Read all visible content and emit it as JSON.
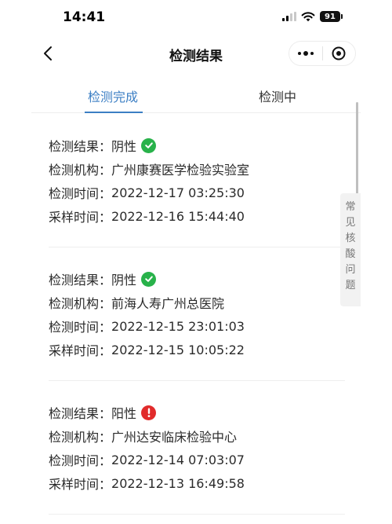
{
  "status_bar": {
    "time": "14:41",
    "battery": "91"
  },
  "nav": {
    "title": "检测结果",
    "more_icon": "more-dots-icon",
    "close_icon": "target-close-icon"
  },
  "tabs": [
    {
      "label": "检测完成",
      "active": true
    },
    {
      "label": "检测中",
      "active": false
    }
  ],
  "faq_chars": [
    "常",
    "见",
    "核",
    "酸",
    "问",
    "题"
  ],
  "labels": {
    "result": "检测结果：",
    "institution": "检测机构：",
    "test_time": "检测时间：",
    "sample_time": "采样时间："
  },
  "records": [
    {
      "result": "阴性",
      "result_icon": "check-circle-icon",
      "institution": "广州康赛医学检验实验室",
      "test_time": "2022-12-17 03:25:30",
      "sample_time": "2022-12-16 15:44:40"
    },
    {
      "result": "阴性",
      "result_icon": "check-circle-icon",
      "institution": "前海人寿广州总医院",
      "test_time": "2022-12-15 23:01:03",
      "sample_time": "2022-12-15 10:05:22"
    },
    {
      "result": "阳性",
      "result_icon": "exclamation-circle-icon",
      "institution": "广州达安临床检验中心",
      "test_time": "2022-12-14 07:03:07",
      "sample_time": "2022-12-13 16:49:58"
    }
  ],
  "colors": {
    "accent": "#3c7fc4",
    "negative_ok": "#28b24a",
    "positive_alert": "#e12b2b"
  }
}
